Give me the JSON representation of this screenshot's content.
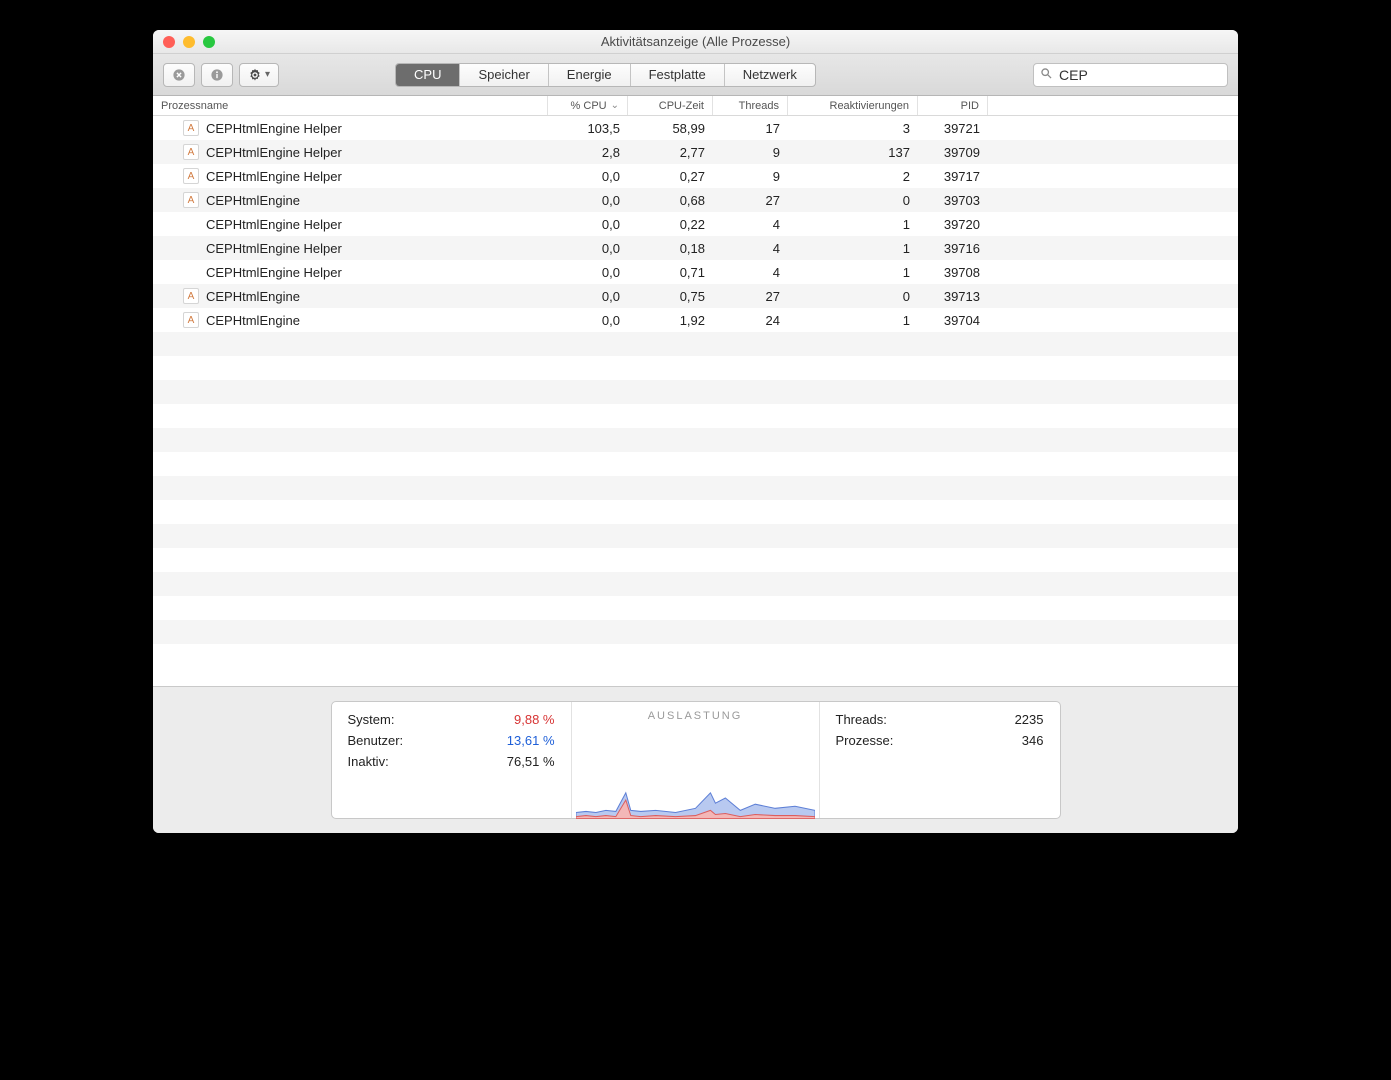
{
  "window": {
    "title": "Aktivitätsanzeige (Alle Prozesse)"
  },
  "toolbar": {
    "tabs": [
      "CPU",
      "Speicher",
      "Energie",
      "Festplatte",
      "Netzwerk"
    ],
    "active_tab_index": 0
  },
  "search": {
    "value": "CEP"
  },
  "columns": {
    "name": "Prozessname",
    "cpu": "% CPU",
    "time": "CPU-Zeit",
    "threads": "Threads",
    "wakeups": "Reaktivierungen",
    "pid": "PID"
  },
  "sort": {
    "column": "cpu",
    "dir": "desc"
  },
  "processes": [
    {
      "icon": true,
      "name": "CEPHtmlEngine Helper",
      "cpu": "103,5",
      "time": "58,99",
      "threads": "17",
      "wake": "3",
      "pid": "39721"
    },
    {
      "icon": true,
      "name": "CEPHtmlEngine Helper",
      "cpu": "2,8",
      "time": "2,77",
      "threads": "9",
      "wake": "137",
      "pid": "39709"
    },
    {
      "icon": true,
      "name": "CEPHtmlEngine Helper",
      "cpu": "0,0",
      "time": "0,27",
      "threads": "9",
      "wake": "2",
      "pid": "39717"
    },
    {
      "icon": true,
      "name": "CEPHtmlEngine",
      "cpu": "0,0",
      "time": "0,68",
      "threads": "27",
      "wake": "0",
      "pid": "39703"
    },
    {
      "icon": false,
      "name": "CEPHtmlEngine Helper",
      "cpu": "0,0",
      "time": "0,22",
      "threads": "4",
      "wake": "1",
      "pid": "39720"
    },
    {
      "icon": false,
      "name": "CEPHtmlEngine Helper",
      "cpu": "0,0",
      "time": "0,18",
      "threads": "4",
      "wake": "1",
      "pid": "39716"
    },
    {
      "icon": false,
      "name": "CEPHtmlEngine Helper",
      "cpu": "0,0",
      "time": "0,71",
      "threads": "4",
      "wake": "1",
      "pid": "39708"
    },
    {
      "icon": true,
      "name": "CEPHtmlEngine",
      "cpu": "0,0",
      "time": "0,75",
      "threads": "27",
      "wake": "0",
      "pid": "39713"
    },
    {
      "icon": true,
      "name": "CEPHtmlEngine",
      "cpu": "0,0",
      "time": "1,92",
      "threads": "24",
      "wake": "1",
      "pid": "39704"
    }
  ],
  "footer": {
    "system_label": "System:",
    "system_val": "9,88 %",
    "user_label": "Benutzer:",
    "user_val": "13,61 %",
    "idle_label": "Inaktiv:",
    "idle_val": "76,51 %",
    "chart_title": "AUSLASTUNG",
    "threads_label": "Threads:",
    "threads_val": "2235",
    "procs_label": "Prozesse:",
    "procs_val": "346"
  }
}
